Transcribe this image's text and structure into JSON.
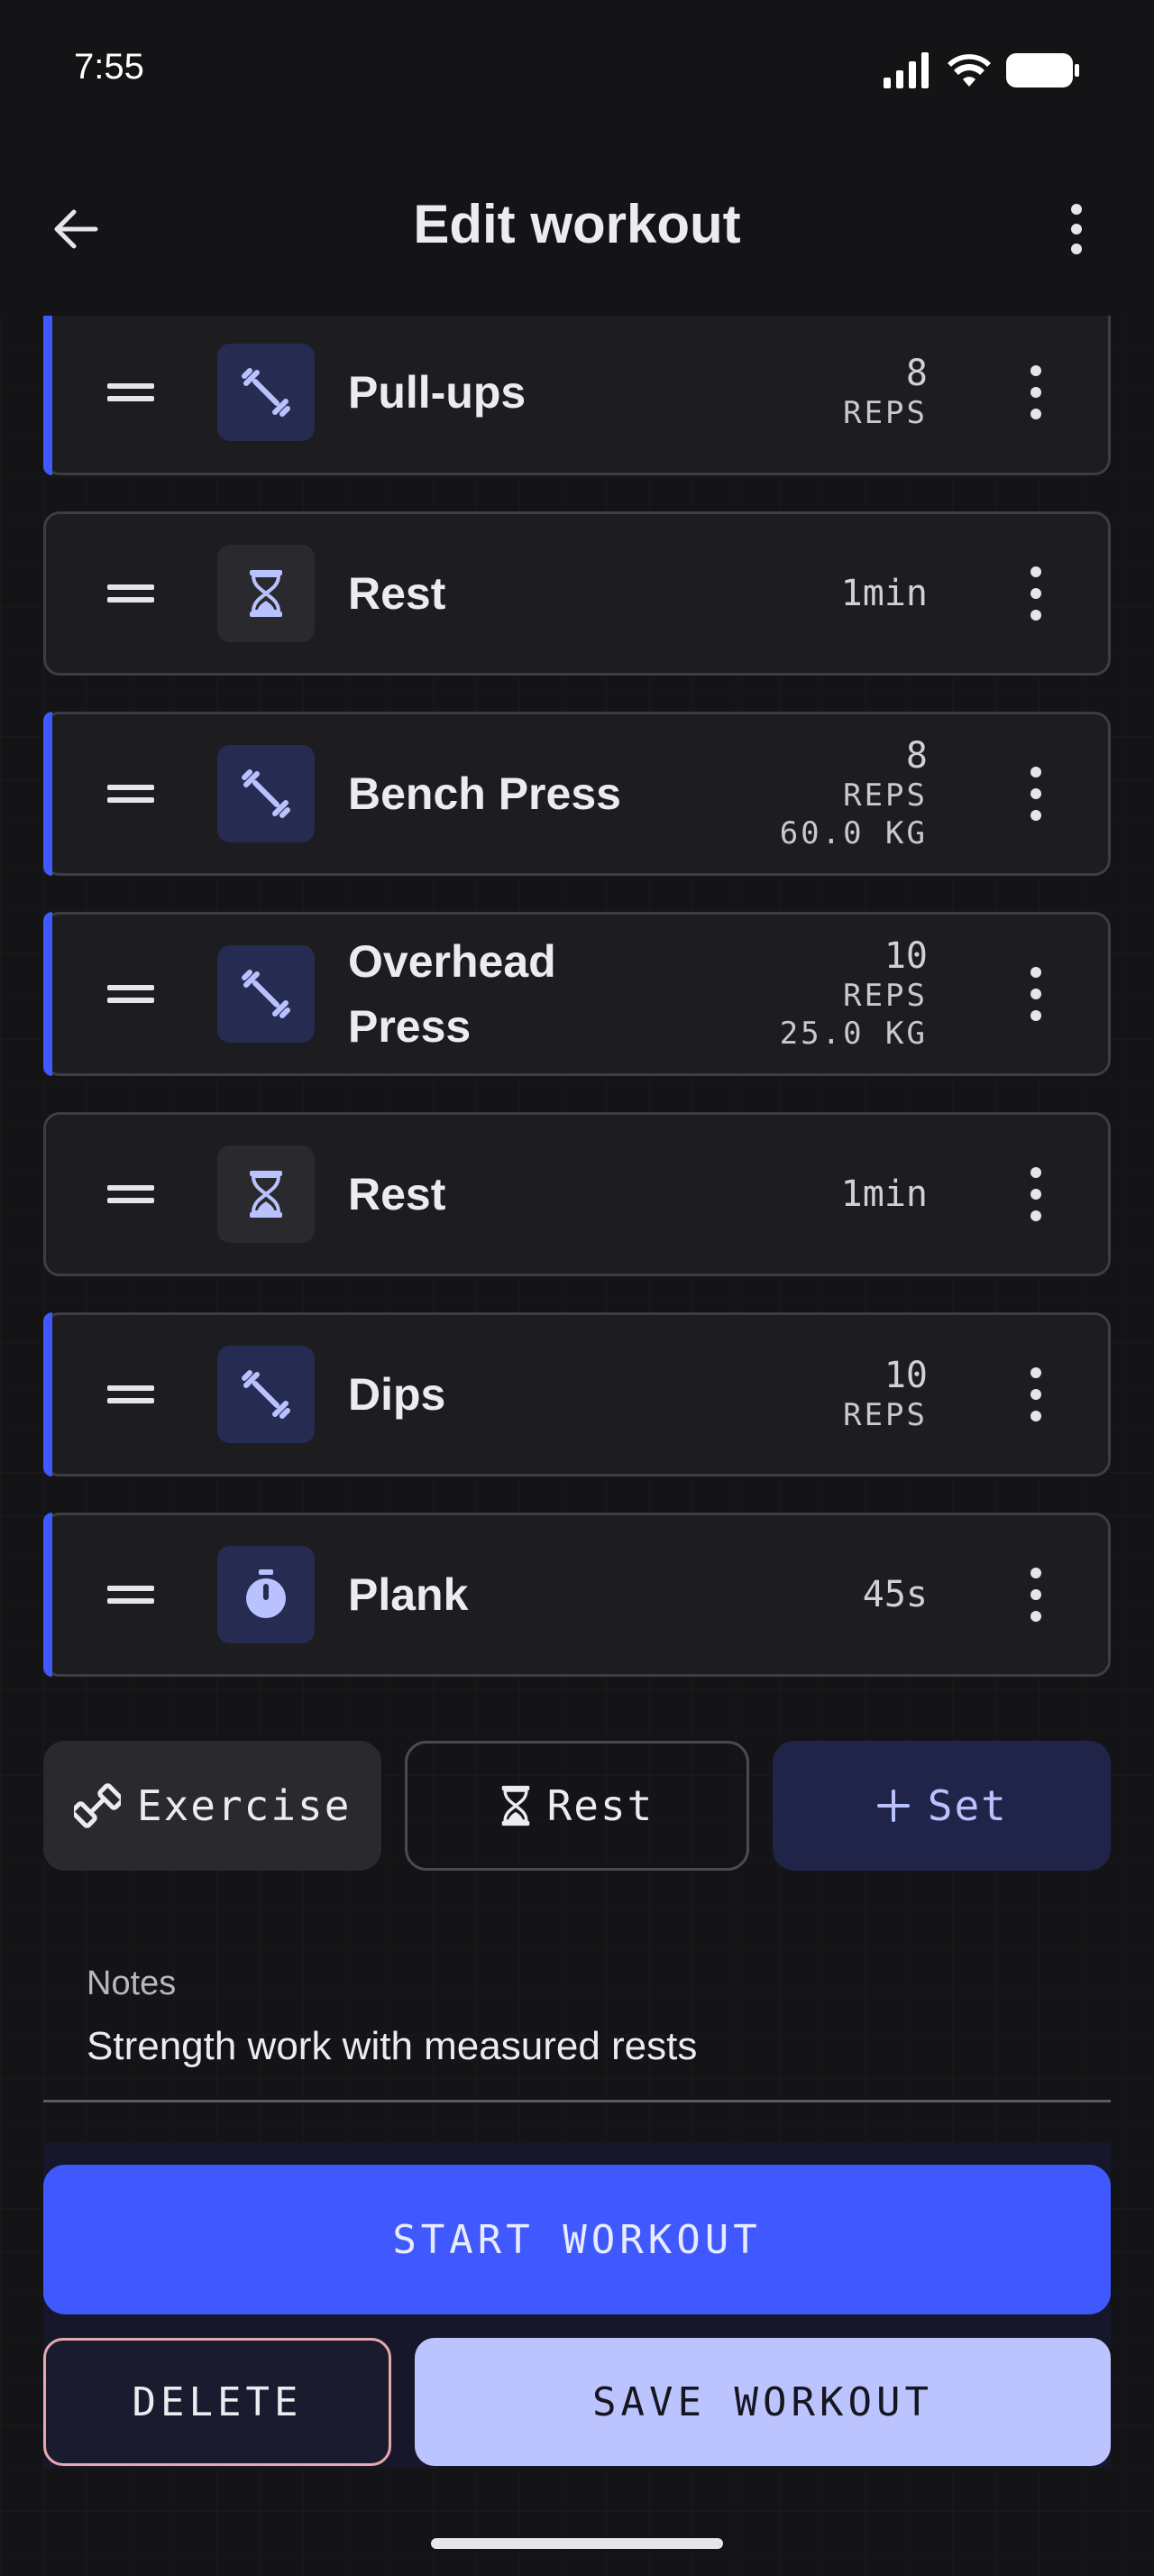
{
  "status_bar": {
    "time": "7:55"
  },
  "app_bar": {
    "title": "Edit workout"
  },
  "items": [
    {
      "type": "exercise",
      "icon": "dumbbell-icon",
      "name": "Pull-ups",
      "line1": "8",
      "line2": "REPS",
      "line3": ""
    },
    {
      "type": "rest",
      "icon": "hourglass-icon",
      "name": "Rest",
      "line1": "1min",
      "line2": "",
      "line3": ""
    },
    {
      "type": "exercise",
      "icon": "dumbbell-icon",
      "name": "Bench Press",
      "line1": "8",
      "line2": "REPS",
      "line3": "60.0 KG"
    },
    {
      "type": "exercise",
      "icon": "dumbbell-icon",
      "name": "Overhead Press",
      "line1": "10",
      "line2": "REPS",
      "line3": "25.0 KG"
    },
    {
      "type": "rest",
      "icon": "hourglass-icon",
      "name": "Rest",
      "line1": "1min",
      "line2": "",
      "line3": ""
    },
    {
      "type": "exercise",
      "icon": "dumbbell-icon",
      "name": "Dips",
      "line1": "10",
      "line2": "REPS",
      "line3": ""
    },
    {
      "type": "exercise",
      "icon": "stopwatch-icon",
      "name": "Plank",
      "line1": "45s",
      "line2": "",
      "line3": ""
    }
  ],
  "add_buttons": {
    "exercise": "Exercise",
    "rest": "Rest",
    "set": "Set"
  },
  "notes": {
    "label": "Notes",
    "value": "Strength work with measured rests"
  },
  "actions": {
    "start": "START WORKOUT",
    "delete": "DELETE",
    "save": "SAVE WORKOUT"
  },
  "colors": {
    "accent": "#3f59ff",
    "save": "#bcc4ff",
    "delete_border": "#e9a8b0"
  }
}
